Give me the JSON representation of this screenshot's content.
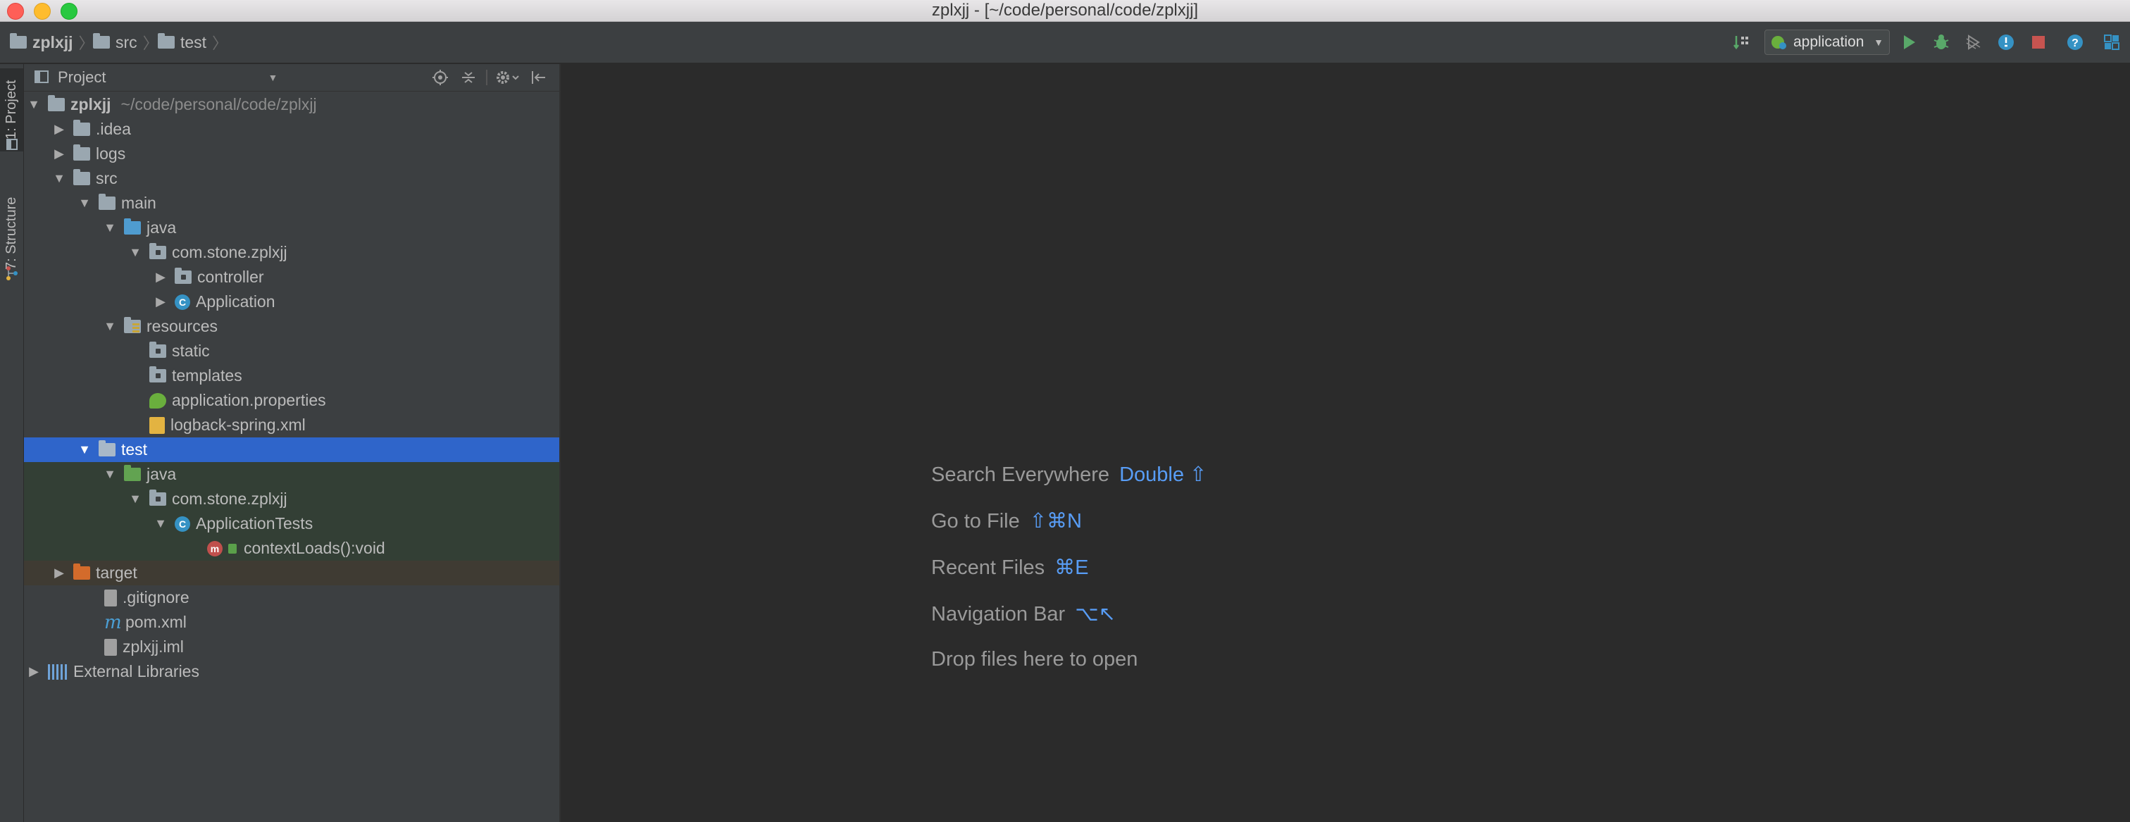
{
  "window": {
    "title": "zplxjj - [~/code/personal/code/zplxjj]"
  },
  "breadcrumb": {
    "items": [
      "zplxjj",
      "src",
      "test"
    ]
  },
  "toolbar": {
    "run_config": "application",
    "icons": [
      "build-icon",
      "run-config-icon",
      "run-icon",
      "debug-icon",
      "coverage-icon",
      "profiler-icon",
      "stop-icon",
      "help-icon",
      "project-structure-icon"
    ]
  },
  "side_tabs": {
    "project": "1: Project",
    "structure": "7: Structure"
  },
  "panel": {
    "title": "Project"
  },
  "tree": {
    "root_name": "zplxjj",
    "root_path": "~/code/personal/code/zplxjj",
    "idea": ".idea",
    "logs": "logs",
    "src": "src",
    "main": "main",
    "main_java": "java",
    "main_pkg": "com.stone.zplxjj",
    "controller": "controller",
    "application": "Application",
    "resources": "resources",
    "static": "static",
    "templates": "templates",
    "app_props": "application.properties",
    "logback": "logback-spring.xml",
    "test": "test",
    "test_java": "java",
    "test_pkg": "com.stone.zplxjj",
    "app_tests": "ApplicationTests",
    "context_loads": "contextLoads():void",
    "target": "target",
    "gitignore": ".gitignore",
    "pom": "pom.xml",
    "iml": "zplxjj.iml",
    "ext_libs": "External Libraries"
  },
  "editor_tips": [
    {
      "label": "Search Everywhere",
      "key": "Double ⇧"
    },
    {
      "label": "Go to File",
      "key": "⇧⌘N"
    },
    {
      "label": "Recent Files",
      "key": "⌘E"
    },
    {
      "label": "Navigation Bar",
      "key": "⌥↖"
    },
    {
      "label": "Drop files here to open",
      "key": ""
    }
  ]
}
